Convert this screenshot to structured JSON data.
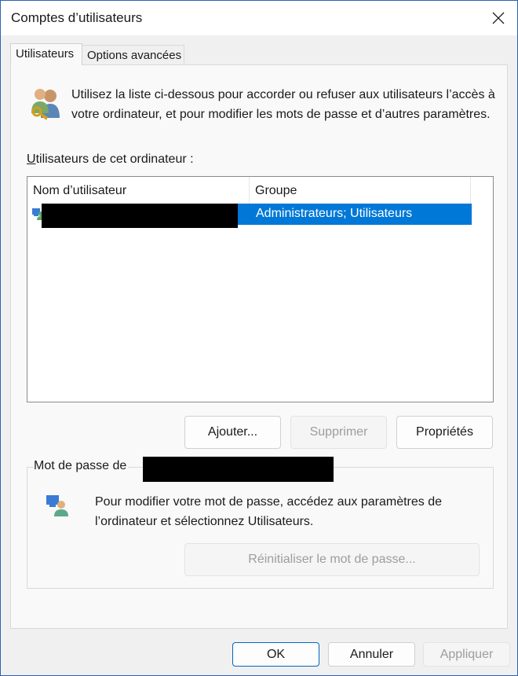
{
  "window": {
    "title": "Comptes d’utilisateurs",
    "close_icon": "close-icon"
  },
  "tabs": [
    {
      "label": "Utilisateurs",
      "active": true
    },
    {
      "label": "Options avancées",
      "active": false
    }
  ],
  "intro": {
    "icon": "users-keys-icon",
    "text": "Utilisez la liste ci-dessous pour accorder ou refuser aux utilisateurs l’accès à votre ordinateur, et pour modifier les mots de passe et d’autres paramètres."
  },
  "users_list": {
    "label": "Utilisateurs de cet ordinateur :",
    "columns": [
      "Nom d’utilisateur",
      "Groupe"
    ],
    "rows": [
      {
        "username": "",
        "username_redacted": true,
        "group": "Administrateurs; Utilisateurs",
        "selected": true,
        "icon": "user-account-icon"
      }
    ]
  },
  "list_buttons": {
    "add": "Ajouter...",
    "remove": "Supprimer",
    "properties": "Propriétés"
  },
  "password_group": {
    "label": "Mot de passe de",
    "icon": "user-password-icon",
    "text": "Pour modifier votre mot de passe, accédez aux paramètres de l’ordinateur et sélectionnez Utilisateurs.",
    "reset_button": "Réinitialiser le mot de passe..."
  },
  "dialog_buttons": {
    "ok": "OK",
    "cancel": "Annuler",
    "apply": "Appliquer"
  },
  "colors": {
    "accent": "#0078d7",
    "window_border": "#2b62b5",
    "disabled_text": "#9d9d9d"
  }
}
